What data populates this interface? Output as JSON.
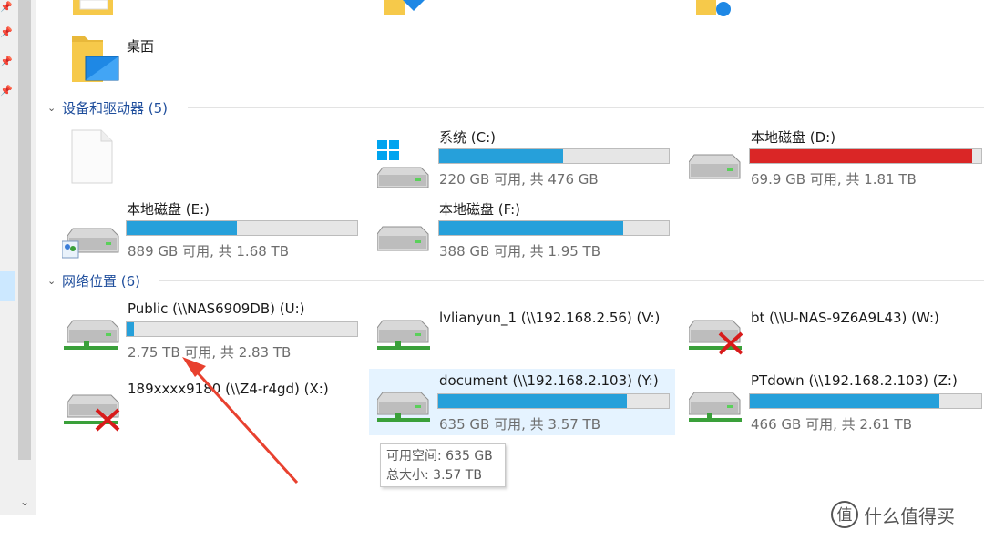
{
  "folders_top": [
    {
      "name": "桌面"
    }
  ],
  "groups": {
    "devices": {
      "title": "设备和驱动器 (5)"
    },
    "network": {
      "title": "网络位置 (6)"
    }
  },
  "drives": [
    {
      "label": "系统 (C:)",
      "info": "220 GB 可用, 共 476 GB",
      "used_fraction": 0.54,
      "bar_color": "#26a0da",
      "icon": "windows-drive-icon"
    },
    {
      "label": "本地磁盘 (D:)",
      "info": "69.9 GB 可用, 共 1.81 TB",
      "used_fraction": 0.96,
      "bar_color": "#da2626",
      "icon": "drive-icon"
    },
    {
      "label": "本地磁盘 (E:)",
      "info": "889 GB 可用, 共 1.68 TB",
      "used_fraction": 0.48,
      "bar_color": "#26a0da",
      "icon": "shared-drive-icon"
    },
    {
      "label": "本地磁盘 (F:)",
      "info": "388 GB 可用, 共 1.95 TB",
      "used_fraction": 0.8,
      "bar_color": "#26a0da",
      "icon": "drive-icon"
    }
  ],
  "network_drives": [
    {
      "label": "Public (\\\\NAS6909DB) (U:)",
      "info": "2.75 TB 可用, 共 2.83 TB",
      "used_fraction": 0.03,
      "bar_color": "#26a0da",
      "connected": true
    },
    {
      "label": "lvlianyun_1 (\\\\192.168.2.56) (V:)",
      "connected": true
    },
    {
      "label": "bt (\\\\U-NAS-9Z6A9L43) (W:)",
      "connected": false
    },
    {
      "label": "189xxxx9180 (\\\\Z4-r4gd) (X:)",
      "connected": false
    },
    {
      "label": "document (\\\\192.168.2.103) (Y:)",
      "info": "635 GB 可用, 共 3.57 TB",
      "used_fraction": 0.82,
      "bar_color": "#26a0da",
      "connected": true
    },
    {
      "label": "PTdown (\\\\192.168.2.103) (Z:)",
      "info": "466 GB 可用, 共 2.61 TB",
      "used_fraction": 0.82,
      "bar_color": "#26a0da",
      "connected": true
    }
  ],
  "tooltip": {
    "line1": "可用空间: 635 GB",
    "line2": "总大小: 3.57 TB"
  },
  "watermark": {
    "logo": "值",
    "text": "什么值得买"
  },
  "colors": {
    "accent": "#26a0da",
    "warning": "#da2626",
    "selection": "#e5f3ff",
    "header_text": "#1f4e9c",
    "annotation_arrow": "#e8412f"
  }
}
